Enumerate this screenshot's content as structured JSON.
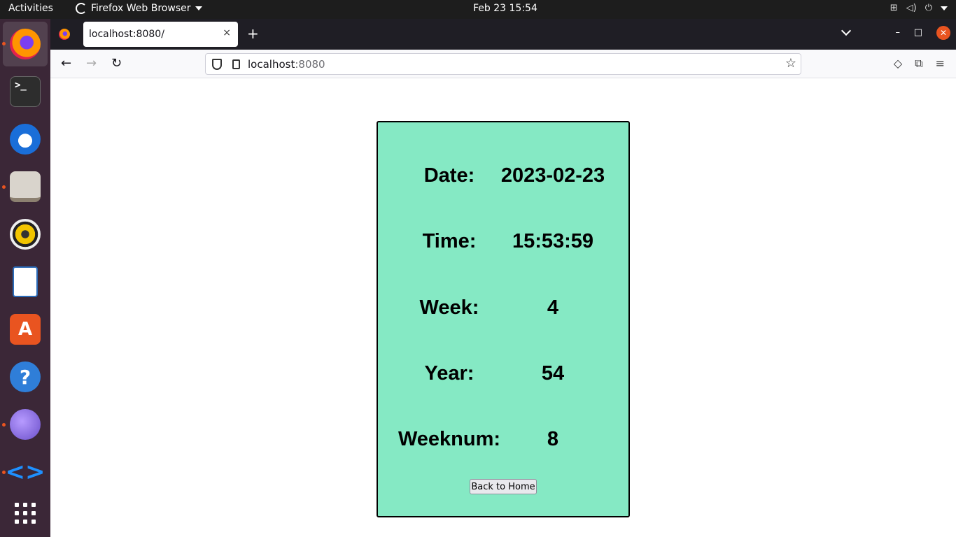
{
  "topbar": {
    "activities": "Activities",
    "app_name": "Firefox Web Browser",
    "clock": "Feb 23  15:54",
    "tray_icons": [
      "network-icon",
      "volume-icon",
      "power-icon"
    ]
  },
  "dock": {
    "items": [
      "firefox",
      "terminal",
      "thunderbird",
      "files",
      "rhythmbox",
      "libreoffice-writer",
      "app-center",
      "help",
      "web",
      "vscode",
      "show-apps"
    ],
    "terminal_glyph": ">_",
    "store_glyph": "A",
    "help_glyph": "?",
    "vscode_glyph": "<>",
    "accent": "#e95420"
  },
  "browser": {
    "tab_title": "localhost:8080/",
    "tab_close": "×",
    "new_tab": "+",
    "url_host": "localhost",
    "url_port": ":8080",
    "back": "←",
    "forward": "→",
    "reload": "↻",
    "star": "☆",
    "min": "–",
    "max": "□",
    "close": "✕"
  },
  "card": {
    "background": "#85e9c4",
    "rows": [
      {
        "label": "Date:",
        "value": "2023-02-23"
      },
      {
        "label": "Time:",
        "value": "15:53:59"
      },
      {
        "label": "Week:",
        "value": "4"
      },
      {
        "label": "Year:",
        "value": "54"
      },
      {
        "label": "Weeknum:",
        "value": "8"
      }
    ],
    "button_label": "Back to Home"
  }
}
